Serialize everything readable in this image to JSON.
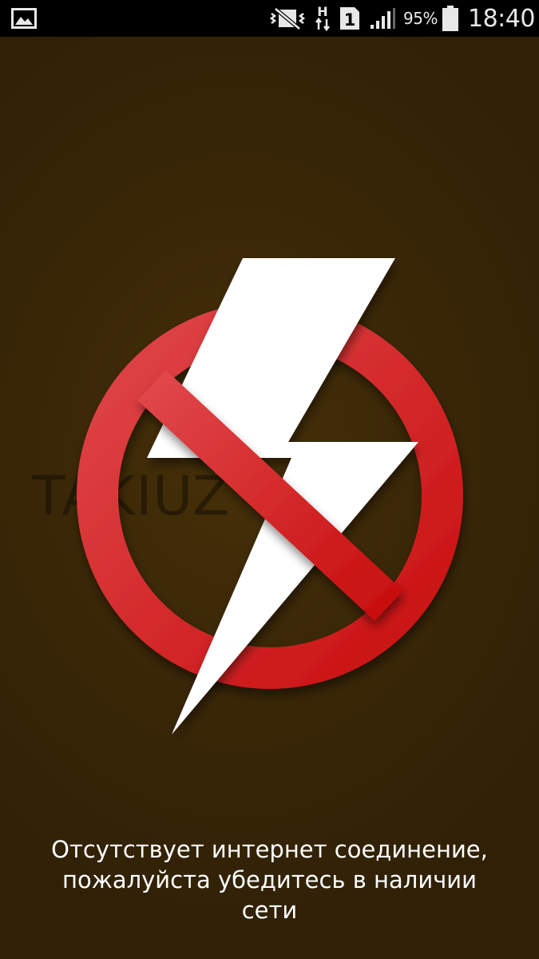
{
  "status_bar": {
    "gallery_icon": "image-icon",
    "mute_icon": "vibrate-mute-icon",
    "network_type": "H",
    "sim_slot": "1",
    "signal_icon": "signal-bars-icon",
    "battery_percent": "95%",
    "battery_icon": "battery-icon",
    "time": "18:40"
  },
  "splash": {
    "logo_text": "TAKIUZ C"
  },
  "error": {
    "icon": "no-power-icon",
    "message_line1": "Отсутствует интернет соединение,",
    "message_line2": "пожалуйста убедитесь в наличии",
    "message_line3": "сети"
  },
  "colors": {
    "background": "#3a2707",
    "prohibition_red": "#d8262a",
    "bolt_white": "#ffffff"
  }
}
